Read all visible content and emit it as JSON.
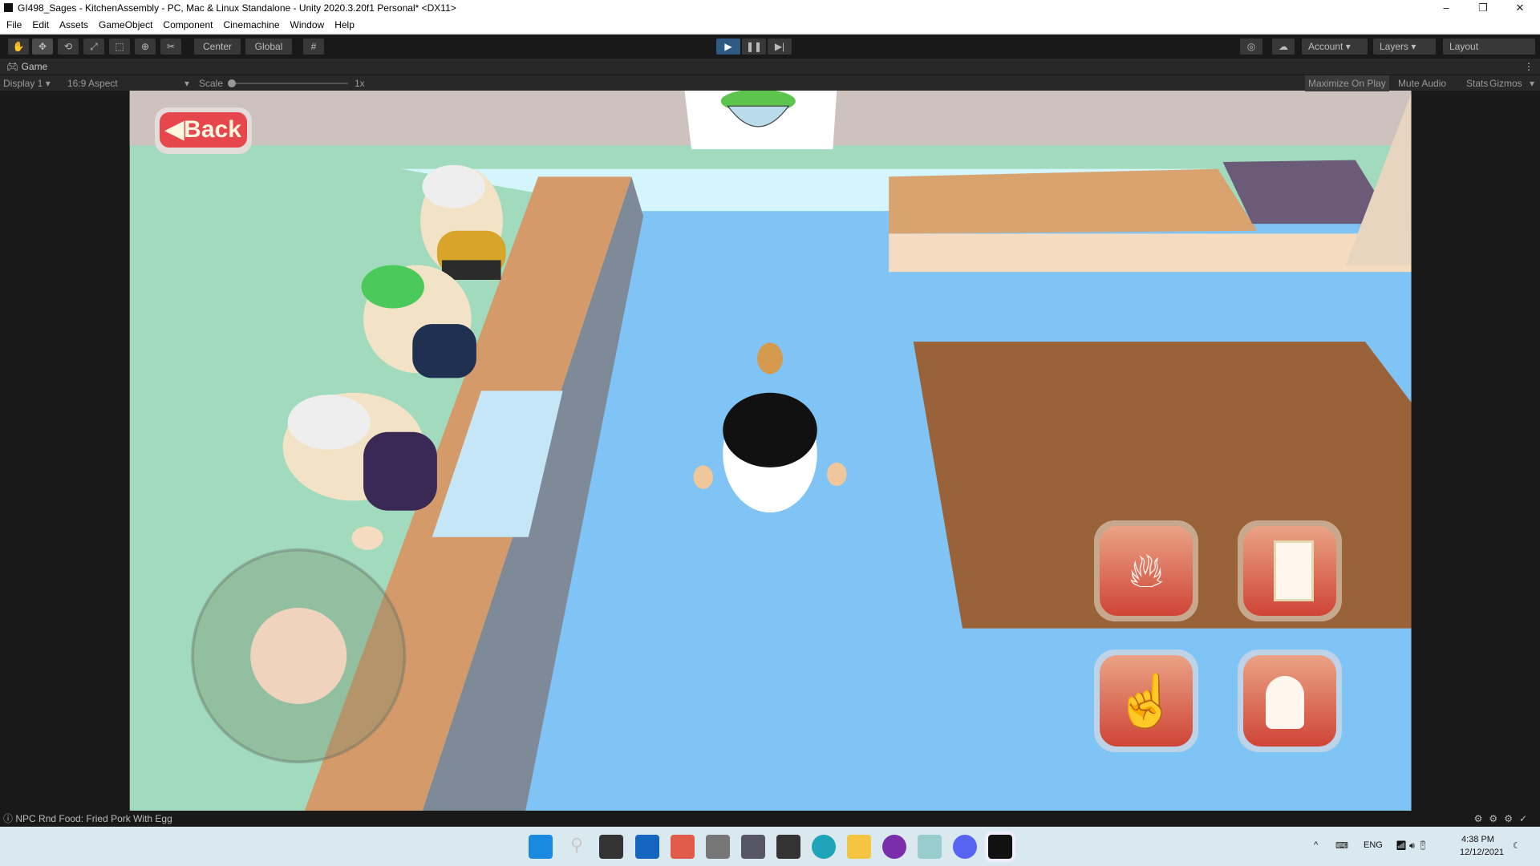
{
  "window": {
    "title": "GI498_Sages - KitchenAssembly - PC, Mac & Linux Standalone - Unity 2020.3.20f1 Personal* <DX11>",
    "minimize": "–",
    "restore": "❐",
    "close": "✕"
  },
  "menu": [
    "File",
    "Edit",
    "Assets",
    "GameObject",
    "Component",
    "Cinemachine",
    "Window",
    "Help"
  ],
  "toolbar": {
    "tools": [
      "hand-tool",
      "move-tool",
      "rotate-tool",
      "scale-tool",
      "rect-tool",
      "transform-tool",
      "custom-tool"
    ],
    "pivot": "Center",
    "space": "Global",
    "account": "Account",
    "layers": "Layers",
    "layout": "Layout",
    "play_state": "playing"
  },
  "game_tab": {
    "label": "Game",
    "display": "Display 1",
    "aspect": "16:9 Aspect",
    "scale_label": "Scale",
    "scale_value": "1x",
    "maximize": "Maximize On Play",
    "mute": "Mute Audio",
    "stats": "Stats",
    "gizmos": "Gizmos"
  },
  "game": {
    "back_button": "Back",
    "action_buttons": [
      "fire",
      "fridge",
      "interact",
      "serve"
    ],
    "colors": {
      "button": "#d9584a",
      "floor": "#7fc4f5",
      "counter": "#d49a6a"
    }
  },
  "status": {
    "message": "NPC Rnd Food: Fried Pork With Egg"
  },
  "taskbar": {
    "lang": "ENG",
    "time": "4:38 PM",
    "date": "12/12/2021"
  }
}
